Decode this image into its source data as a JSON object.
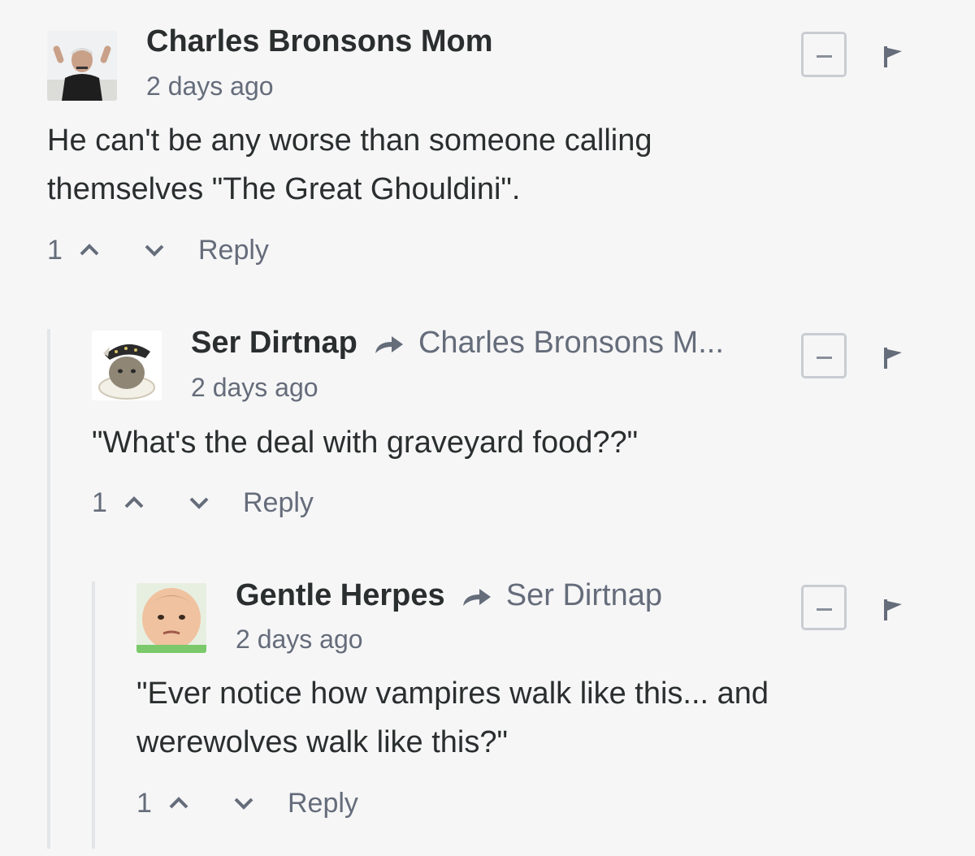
{
  "comments": [
    {
      "author": "Charles Bronsons Mom",
      "reply_to": "",
      "timestamp": "2 days ago",
      "body_lines": [
        "He can't be any worse than someone calling",
        "themselves \"The Great Ghouldini\"."
      ],
      "votes": "1",
      "reply_label": "Reply"
    },
    {
      "author": "Ser Dirtnap",
      "reply_to": "Charles Bronsons M...",
      "timestamp": "2 days ago",
      "body_lines": [
        "\"What's the deal with graveyard food??\""
      ],
      "votes": "1",
      "reply_label": "Reply"
    },
    {
      "author": "Gentle Herpes",
      "reply_to": "Ser Dirtnap",
      "timestamp": "2 days ago",
      "body_lines": [
        "\"Ever notice how vampires walk like this... and",
        "werewolves walk like this?\""
      ],
      "votes": "1",
      "reply_label": "Reply"
    }
  ],
  "icons": {
    "collapse": "minus-square-icon",
    "flag": "flag-icon",
    "upvote": "chevron-up-icon",
    "downvote": "chevron-down-icon",
    "reply_arrow": "reply-arrow-icon"
  },
  "colors": {
    "background": "#f6f6f7",
    "author": "#2a2e2e",
    "muted": "#656c7a",
    "thread_line": "#e3e5e8"
  }
}
